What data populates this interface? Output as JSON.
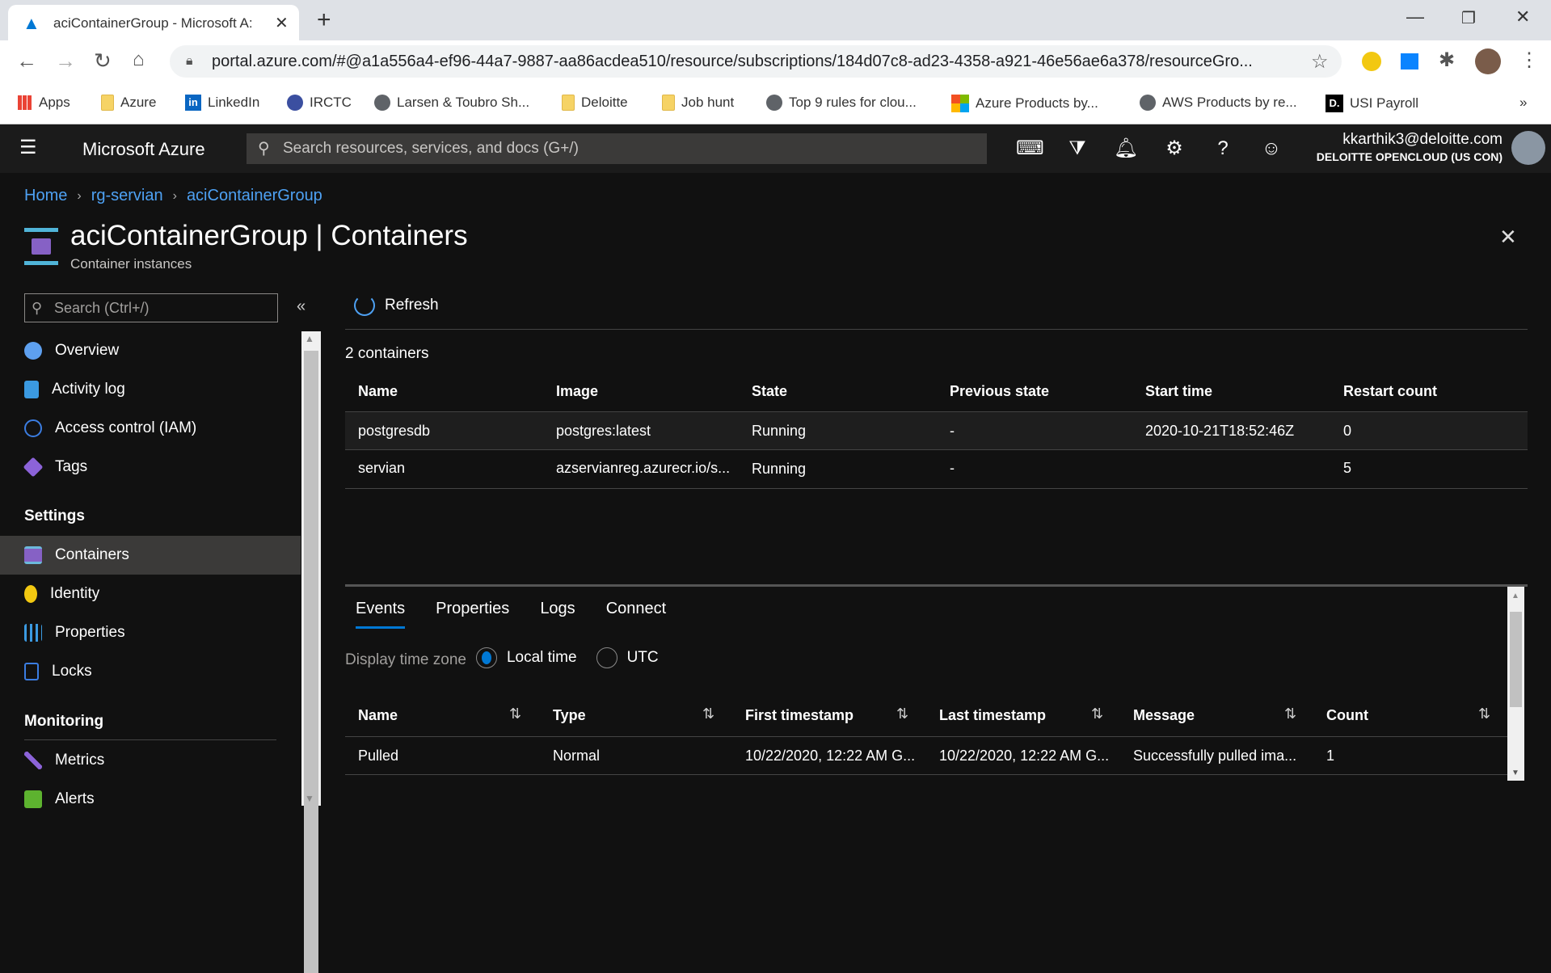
{
  "browser": {
    "tab_title": "aciContainerGroup - Microsoft A:",
    "new_tab": "+",
    "url": "portal.azure.com/#@a1a556a4-ef96-44a7-9887-aa86acdea510/resource/subscriptions/184d07c8-ad23-4358-a921-46e56ae6a378/resourceGro...",
    "bookmarks": [
      "Apps",
      "Azure",
      "LinkedIn",
      "IRCTC",
      "Larsen & Toubro Sh...",
      "Deloitte",
      "Job hunt",
      "Top 9 rules for clou...",
      "Azure Products by...",
      "AWS Products by re...",
      "USI Payroll"
    ],
    "more": "»"
  },
  "header": {
    "brand": "Microsoft Azure",
    "search_placeholder": "Search resources, services, and docs (G+/)",
    "user_email": "kkarthik3@deloitte.com",
    "tenant": "DELOITTE OPENCLOUD (US CON)"
  },
  "breadcrumb": [
    "Home",
    "rg-servian",
    "aciContainerGroup"
  ],
  "page": {
    "title": "aciContainerGroup | Containers",
    "subtitle": "Container instances"
  },
  "sidebar": {
    "search_placeholder": "Search (Ctrl+/)",
    "collapse": "«",
    "items": [
      {
        "label": "Overview",
        "color": "#5ea0ef"
      },
      {
        "label": "Activity log",
        "color": "#3b9ae1"
      },
      {
        "label": "Access control (IAM)",
        "color": "#3b7de1"
      },
      {
        "label": "Tags",
        "color": "#8c63d9"
      }
    ],
    "settings_header": "Settings",
    "settings": [
      {
        "label": "Containers",
        "selected": true,
        "color": "#6cb9dc"
      },
      {
        "label": "Identity",
        "color": "#f2c811"
      },
      {
        "label": "Properties",
        "color": "#3b9ae1"
      },
      {
        "label": "Locks",
        "color": "#3b7de1"
      }
    ],
    "monitoring_header": "Monitoring",
    "monitoring": [
      {
        "label": "Metrics",
        "color": "#8c63d9"
      },
      {
        "label": "Alerts",
        "color": "#5db32f"
      }
    ]
  },
  "toolbar": {
    "refresh": "Refresh"
  },
  "containers": {
    "count_label": "2 containers",
    "columns": [
      "Name",
      "Image",
      "State",
      "Previous state",
      "Start time",
      "Restart count"
    ],
    "rows": [
      [
        "postgresdb",
        "postgres:latest",
        "Running",
        "-",
        "2020-10-21T18:52:46Z",
        "0"
      ],
      [
        "servian",
        "azservianreg.azurecr.io/s...",
        "Running",
        "-",
        "",
        "5"
      ]
    ]
  },
  "details": {
    "tabs": [
      "Events",
      "Properties",
      "Logs",
      "Connect"
    ],
    "active_tab": "Events",
    "timezone_label": "Display time zone",
    "timezone_options": [
      "Local time",
      "UTC"
    ],
    "timezone_selected": "Local time",
    "columns": [
      "Name",
      "Type",
      "First timestamp",
      "Last timestamp",
      "Message",
      "Count"
    ],
    "rows": [
      [
        "Pulled",
        "Normal",
        "10/22/2020, 12:22 AM G...",
        "10/22/2020, 12:22 AM G...",
        "Successfully pulled ima...",
        "1"
      ]
    ]
  },
  "colors": {
    "accent": "#0078d4",
    "link": "#4ea1f3"
  }
}
